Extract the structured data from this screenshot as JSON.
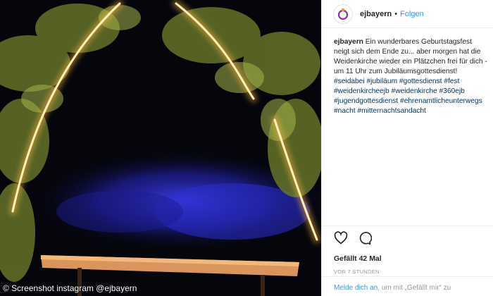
{
  "photo": {
    "alt": "",
    "credit": "© Screenshot instagram @ejbayern"
  },
  "header": {
    "username": "ejbayern",
    "separator": "•",
    "follow_label": "Folgen"
  },
  "caption": {
    "user": "ejbayern",
    "text": "Ein wunderbares Geburtstagsfest neigt sich dem Ende zu... aber morgen hat die Weidenkirche wieder ein Plätzchen frei für dich - um 11 Uhr zum Jubiläumsgottesdienst!",
    "hashtags": "#seidabei #jubiläum #gottesdienst #fest #weidenkircheejb #weidenkirche #360ejb #jugendgottesdienst #ehrenamtlicheunterwegs #nacht #mitternachtsandacht"
  },
  "actions": {
    "like_icon": "heart-icon",
    "comment_icon": "comment-icon",
    "likes_text": "Gefällt 42 Mal",
    "time_text": "VOR 7 STUNDEN"
  },
  "login": {
    "link_text": "Melde dich an",
    "rest_text": ", um mit „Gefällt mir“ zu"
  },
  "colors": {
    "link_blue": "#3897f0",
    "hashtag_blue": "#003569",
    "light_gold": "#ffd77a",
    "blue_light": "#2a2cc8"
  }
}
